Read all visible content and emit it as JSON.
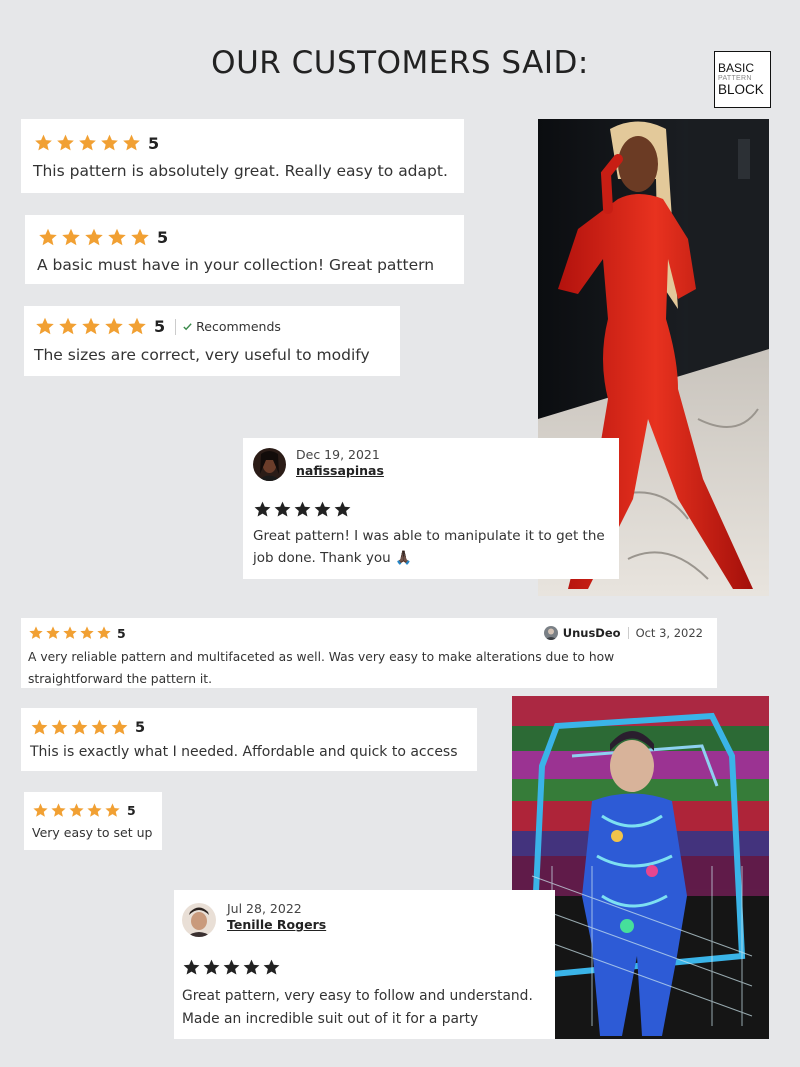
{
  "header": {
    "title": "OUR CUSTOMERS SAID:"
  },
  "logo": {
    "line1": "BASIC",
    "line2": "PATTERN",
    "line3": "BLOCK"
  },
  "colors": {
    "background": "#e6e7e9",
    "star_orange": "#f1a033",
    "star_black": "#222222",
    "check_green": "#3a8a4a"
  },
  "reviews": [
    {
      "rating": 5,
      "rating_label": "5",
      "text": "This pattern is absolutely great. Really easy to adapt."
    },
    {
      "rating": 5,
      "rating_label": "5",
      "text": "A basic must have in your collection! Great pattern"
    },
    {
      "rating": 5,
      "rating_label": "5",
      "recommends": "Recommends",
      "text": "The sizes are correct, very useful to modify"
    },
    {
      "date": "Dec 19, 2021",
      "user": "nafissapinas",
      "rating": 5,
      "text": "Great pattern! I was able to manipulate it to get the",
      "text2": "job done. Thank you",
      "emoji": "🙏🏿"
    },
    {
      "rating": 5,
      "rating_label": "5",
      "user": "UnusDeo",
      "date": "Oct 3, 2022",
      "text": "A very reliable pattern and multifaceted as well. Was very easy to make alterations due to how",
      "text2": "straightforward the pattern it."
    },
    {
      "rating": 5,
      "rating_label": "5",
      "text": "This is exactly what I needed. Affordable and quick to access"
    },
    {
      "rating": 5,
      "rating_label": "5",
      "text": "Very easy to set up"
    },
    {
      "date": "Jul 28, 2022",
      "user": "Tenille Rogers",
      "rating": 5,
      "text": "Great pattern, very easy to follow and understand.",
      "text2": "Made an incredible suit out of it for a party"
    }
  ],
  "icons": {
    "star": "star-icon",
    "check": "check-icon"
  }
}
